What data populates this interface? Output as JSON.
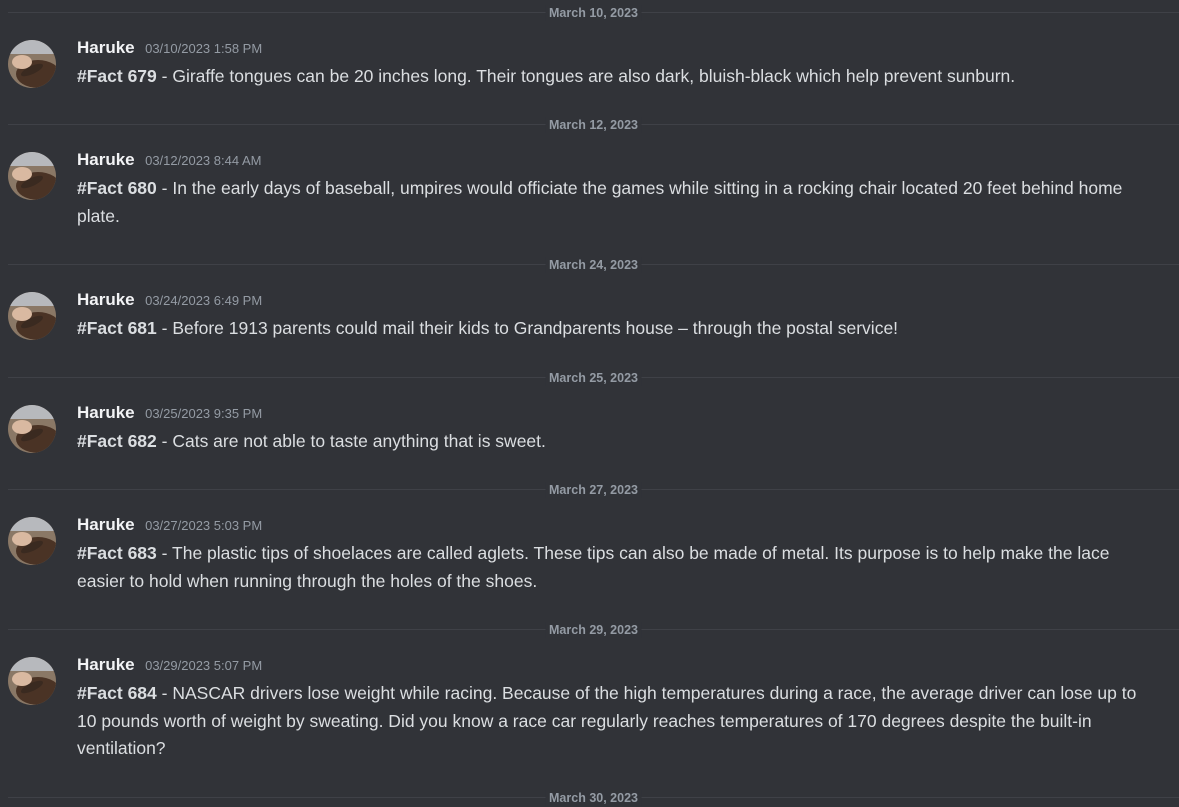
{
  "colors": {
    "background": "#313338",
    "divider_line": "#3f4147",
    "divider_text": "#949ba4",
    "username": "#f2f3f5",
    "timestamp": "#949ba4",
    "message_text": "#dbdee1"
  },
  "avatar_icon": "profile-photo",
  "dividers": [
    {
      "label": "March 10, 2023"
    },
    {
      "label": "March 12, 2023"
    },
    {
      "label": "March 24, 2023"
    },
    {
      "label": "March 25, 2023"
    },
    {
      "label": "March 27, 2023"
    },
    {
      "label": "March 29, 2023"
    },
    {
      "label": "March 30, 2023"
    }
  ],
  "messages": [
    {
      "author": "Haruke",
      "timestamp": "03/10/2023 1:58 PM",
      "tag": "#Fact 679",
      "text": " - Giraffe tongues can be 20 inches long. Their tongues are also dark, bluish-black which help prevent sunburn."
    },
    {
      "author": "Haruke",
      "timestamp": "03/12/2023 8:44 AM",
      "tag": "#Fact 680",
      "text": " - In the early days of baseball, umpires would officiate the games while sitting in a rocking chair located 20 feet behind home plate."
    },
    {
      "author": "Haruke",
      "timestamp": "03/24/2023 6:49 PM",
      "tag": "#Fact 681",
      "text": " - Before 1913 parents could mail their kids to Grandparents house – through the postal service!"
    },
    {
      "author": "Haruke",
      "timestamp": "03/25/2023 9:35 PM",
      "tag": "#Fact 682",
      "text": " - Cats are not able to taste anything that is sweet."
    },
    {
      "author": "Haruke",
      "timestamp": "03/27/2023 5:03 PM",
      "tag": "#Fact 683",
      "text": " - The plastic tips of shoelaces are called aglets. These tips can also be made of metal. Its purpose is to help make the lace easier to hold when running through the holes of the shoes."
    },
    {
      "author": "Haruke",
      "timestamp": "03/29/2023 5:07 PM",
      "tag": "#Fact 684",
      "text": " - NASCAR drivers lose weight while racing. Because of the high temperatures during a race, the average driver can lose up to 10 pounds worth of weight by sweating. Did you know a race car regularly reaches temperatures of 170 degrees despite the built-in ventilation?"
    }
  ]
}
